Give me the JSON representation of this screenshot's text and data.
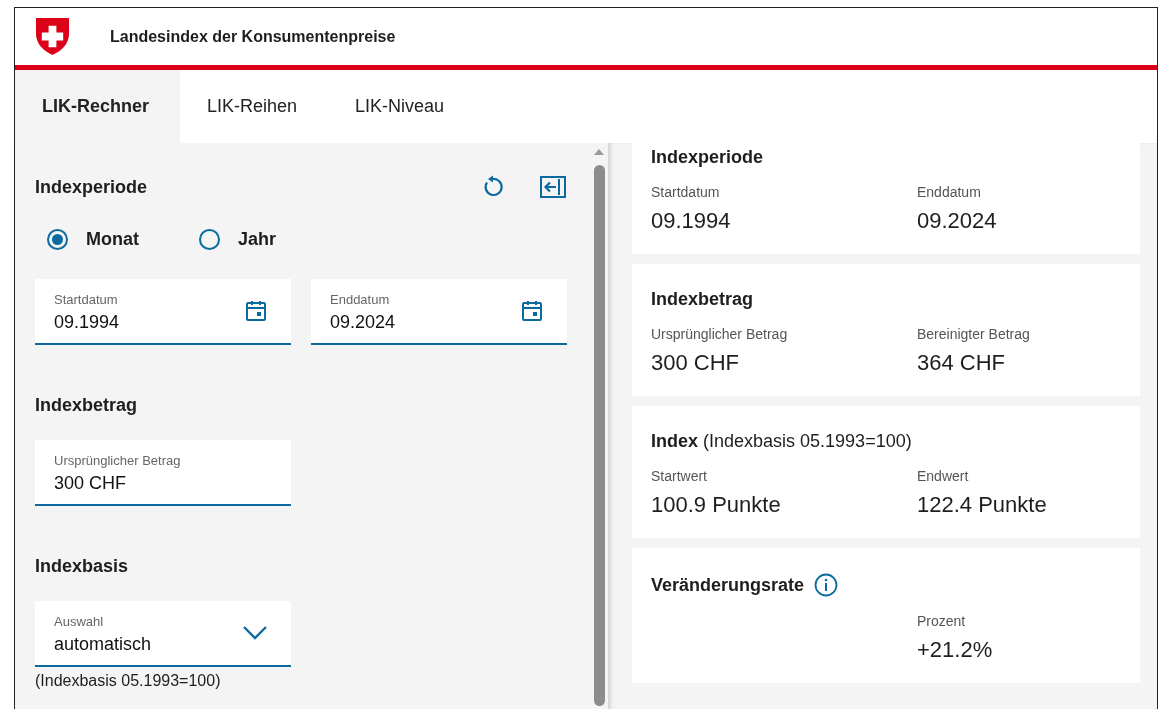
{
  "header": {
    "title": "Landesindex der Konsumentenpreise"
  },
  "tabs": [
    {
      "label": "LIK-Rechner",
      "selected": true
    },
    {
      "label": "LIK-Reihen",
      "selected": false
    },
    {
      "label": "LIK-Niveau",
      "selected": false
    }
  ],
  "calculator": {
    "period": {
      "title": "Indexperiode",
      "modes": [
        {
          "label": "Monat",
          "selected": true
        },
        {
          "label": "Jahr",
          "selected": false
        }
      ],
      "fields": [
        {
          "label": "Startdatum",
          "value": "09.1994"
        },
        {
          "label": "Enddatum",
          "value": "09.2024"
        }
      ]
    },
    "amount": {
      "title": "Indexbetrag",
      "field": {
        "label": "Ursprünglicher Betrag",
        "value": "300 CHF"
      }
    },
    "basis": {
      "title": "Indexbasis",
      "select": {
        "label": "Auswahl",
        "value": "automatisch"
      },
      "note": "(Indexbasis 05.1993=100)"
    }
  },
  "results": [
    {
      "title": "Indexperiode",
      "items": [
        {
          "label": "Startdatum",
          "value": "09.1994"
        },
        {
          "label": "Enddatum",
          "value": "09.2024"
        }
      ]
    },
    {
      "title": "Indexbetrag",
      "items": [
        {
          "label": "Ursprünglicher Betrag",
          "value": "300 CHF"
        },
        {
          "label": "Bereinigter Betrag",
          "value": "364 CHF"
        }
      ]
    },
    {
      "title": "**Index** (Indexbasis 05.1993=100)",
      "items": [
        {
          "label": "Startwert",
          "value": "100.9 Punkte"
        },
        {
          "label": "Endwert",
          "value": "122.4 Punkte"
        }
      ]
    },
    {
      "title": "Veränderungsrate",
      "info": true,
      "items": [
        {
          "label": "Prozent",
          "value": "+21.2%"
        }
      ]
    }
  ]
}
